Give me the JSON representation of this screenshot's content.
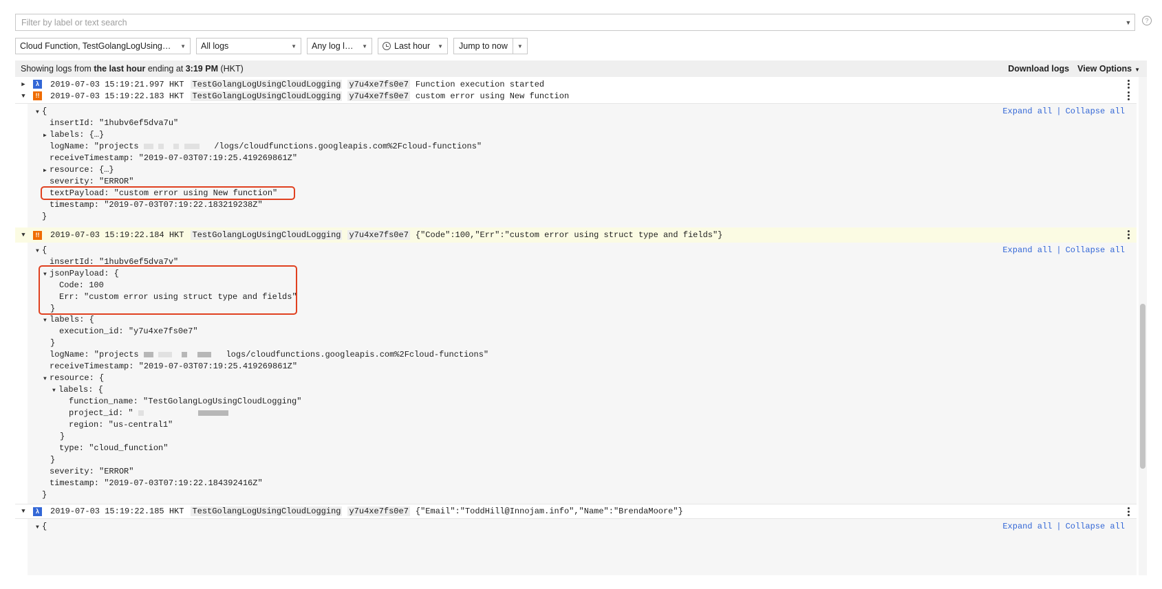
{
  "filter": {
    "placeholder": "Filter by label or text search"
  },
  "help_icon": "?",
  "toolbar": {
    "resource": "Cloud Function, TestGolangLogUsingClo...",
    "logs": "All logs",
    "level": "Any log level",
    "time": "Last hour",
    "jump": "Jump to now"
  },
  "status": {
    "prefix": "Showing logs from",
    "range": "the last hour",
    "middle": "ending at",
    "time": "3:19 PM",
    "tz": "(HKT)",
    "download": "Download logs",
    "view_options": "View Options"
  },
  "expand_all": "Expand all",
  "separator": "|",
  "collapse_all": "Collapse all",
  "entries": [
    {
      "severity_icon": "λ",
      "timestamp": "2019-07-03 15:19:21.997 HKT",
      "function": "TestGolangLogUsingCloudLogging",
      "execution": "y7u4xe7fs0e7",
      "message": "Function execution started"
    },
    {
      "severity_icon": "!!",
      "timestamp": "2019-07-03 15:19:22.183 HKT",
      "function": "TestGolangLogUsingCloudLogging",
      "execution": "y7u4xe7fs0e7",
      "message": "custom error using New function"
    },
    {
      "severity_icon": "!!",
      "timestamp": "2019-07-03 15:19:22.184 HKT",
      "function": "TestGolangLogUsingCloudLogging",
      "execution": "y7u4xe7fs0e7",
      "message": "{\"Code\":100,\"Err\":\"custom error using struct type and fields\"}"
    },
    {
      "severity_icon": "λ",
      "timestamp": "2019-07-03 15:19:22.185 HKT",
      "function": "TestGolangLogUsingCloudLogging",
      "execution": "y7u4xe7fs0e7",
      "message": "{\"Email\":\"ToddHill@Innojam.info\",\"Name\":\"BrendaMoore\"}"
    }
  ],
  "detail1": {
    "open": "{",
    "insertId": "insertId: \"1hubv6ef5dva7u\"",
    "labels": "labels: {…}",
    "logName_a": "logName: \"projects",
    "logName_b": "/logs/cloudfunctions.googleapis.com%2Fcloud-functions\"",
    "receiveTimestamp": "receiveTimestamp: \"2019-07-03T07:19:25.419269861Z\"",
    "resource": "resource: {…}",
    "severity": "severity: \"ERROR\"",
    "textPayload": "textPayload: \"custom error using New function\"",
    "timestamp": "timestamp: \"2019-07-03T07:19:22.183219238Z\"",
    "close": "}"
  },
  "detail2": {
    "open": "{",
    "insertId": "insertId: \"1hubv6ef5dva7v\"",
    "jsonPayload": "jsonPayload: {",
    "code": "Code: 100",
    "err": "Err: \"custom error using struct type and fields\"",
    "jp_close": "}",
    "labels": "labels: {",
    "execution_id": "execution_id: \"y7u4xe7fs0e7\"",
    "labels_close": "}",
    "logName_a": "logName: \"projects",
    "logName_b": "logs/cloudfunctions.googleapis.com%2Fcloud-functions\"",
    "receiveTimestamp": "receiveTimestamp: \"2019-07-03T07:19:25.419269861Z\"",
    "resource": "resource: {",
    "res_labels": "labels: {",
    "function_name": "function_name: \"TestGolangLogUsingCloudLogging\"",
    "project_id": "project_id: \"",
    "region": "region: \"us-central1\"",
    "res_labels_close": "}",
    "type": "type: \"cloud_function\"",
    "resource_close": "}",
    "severity": "severity: \"ERROR\"",
    "timestamp": "timestamp: \"2019-07-03T07:19:22.184392416Z\"",
    "close": "}"
  },
  "detail3": {
    "open": "{"
  }
}
